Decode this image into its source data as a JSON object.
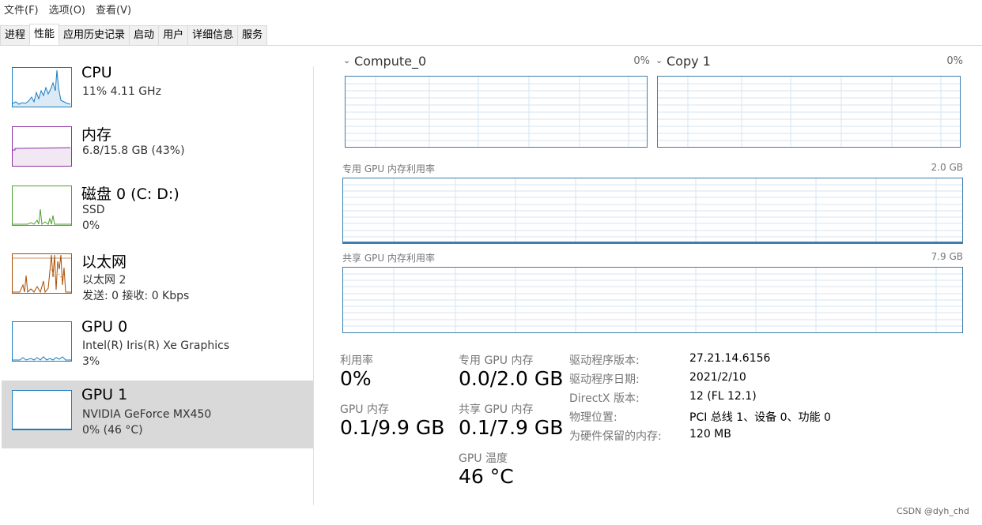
{
  "menu": [
    "文件(F)",
    "选项(O)",
    "查看(V)"
  ],
  "tabs": [
    "进程",
    "性能",
    "应用历史记录",
    "启动",
    "用户",
    "详细信息",
    "服务"
  ],
  "sidebar": [
    {
      "title": "CPU",
      "line1": "11%  4.11 GHz",
      "line2": "",
      "color": "#1a7cc1",
      "icon": "cpu-graph"
    },
    {
      "title": "内存",
      "line1": "6.8/15.8 GB (43%)",
      "line2": "",
      "color": "#8b2fa5",
      "icon": "memory-graph"
    },
    {
      "title": "磁盘 0 (C: D:)",
      "line1": "SSD",
      "line2": "0%",
      "color": "#4da02b",
      "icon": "disk-graph"
    },
    {
      "title": "以太网",
      "line1": "以太网 2",
      "line2": "发送: 0  接收: 0 Kbps",
      "color": "#a74f01",
      "icon": "ethernet-graph"
    },
    {
      "title": "GPU 0",
      "line1": "Intel(R) Iris(R) Xe Graphics",
      "line2": "3%",
      "color": "#1a7cc1",
      "icon": "gpu0-graph"
    },
    {
      "title": "GPU 1",
      "line1": "NVIDIA GeForce MX450",
      "line2": "0%  (46 °C)",
      "color": "#1a7cc1",
      "icon": "gpu1-graph"
    }
  ],
  "engines": [
    {
      "name": "Compute_0",
      "pct": "0%"
    },
    {
      "name": "Copy 1",
      "pct": "0%"
    }
  ],
  "dedicated_graph": {
    "label": "专用 GPU 内存利用率",
    "max": "2.0 GB"
  },
  "shared_graph": {
    "label": "共享 GPU 内存利用率",
    "max": "7.9 GB"
  },
  "stats": {
    "utilization_label": "利用率",
    "utilization_value": "0%",
    "gpu_mem_label": "GPU 内存",
    "gpu_mem_value": "0.1/9.9 GB",
    "dedicated_label": "专用 GPU 内存",
    "dedicated_value": "0.0/2.0 GB",
    "shared_label": "共享 GPU 内存",
    "shared_value": "0.1/7.9 GB",
    "temp_label": "GPU 温度",
    "temp_value": "46 °C"
  },
  "info": [
    {
      "label": "驱动程序版本:",
      "value": "27.21.14.6156"
    },
    {
      "label": "驱动程序日期:",
      "value": "2021/2/10"
    },
    {
      "label": "DirectX 版本:",
      "value": "12 (FL 12.1)"
    },
    {
      "label": "物理位置:",
      "value": "PCI 总线 1、设备 0、功能 0"
    },
    {
      "label": "为硬件保留的内存:",
      "value": "120 MB"
    }
  ],
  "watermark": "CSDN @dyh_chd",
  "colors": {
    "accent": "#3c7faf",
    "grid": "#d6e6f2",
    "selected": "#d9d9d9"
  }
}
